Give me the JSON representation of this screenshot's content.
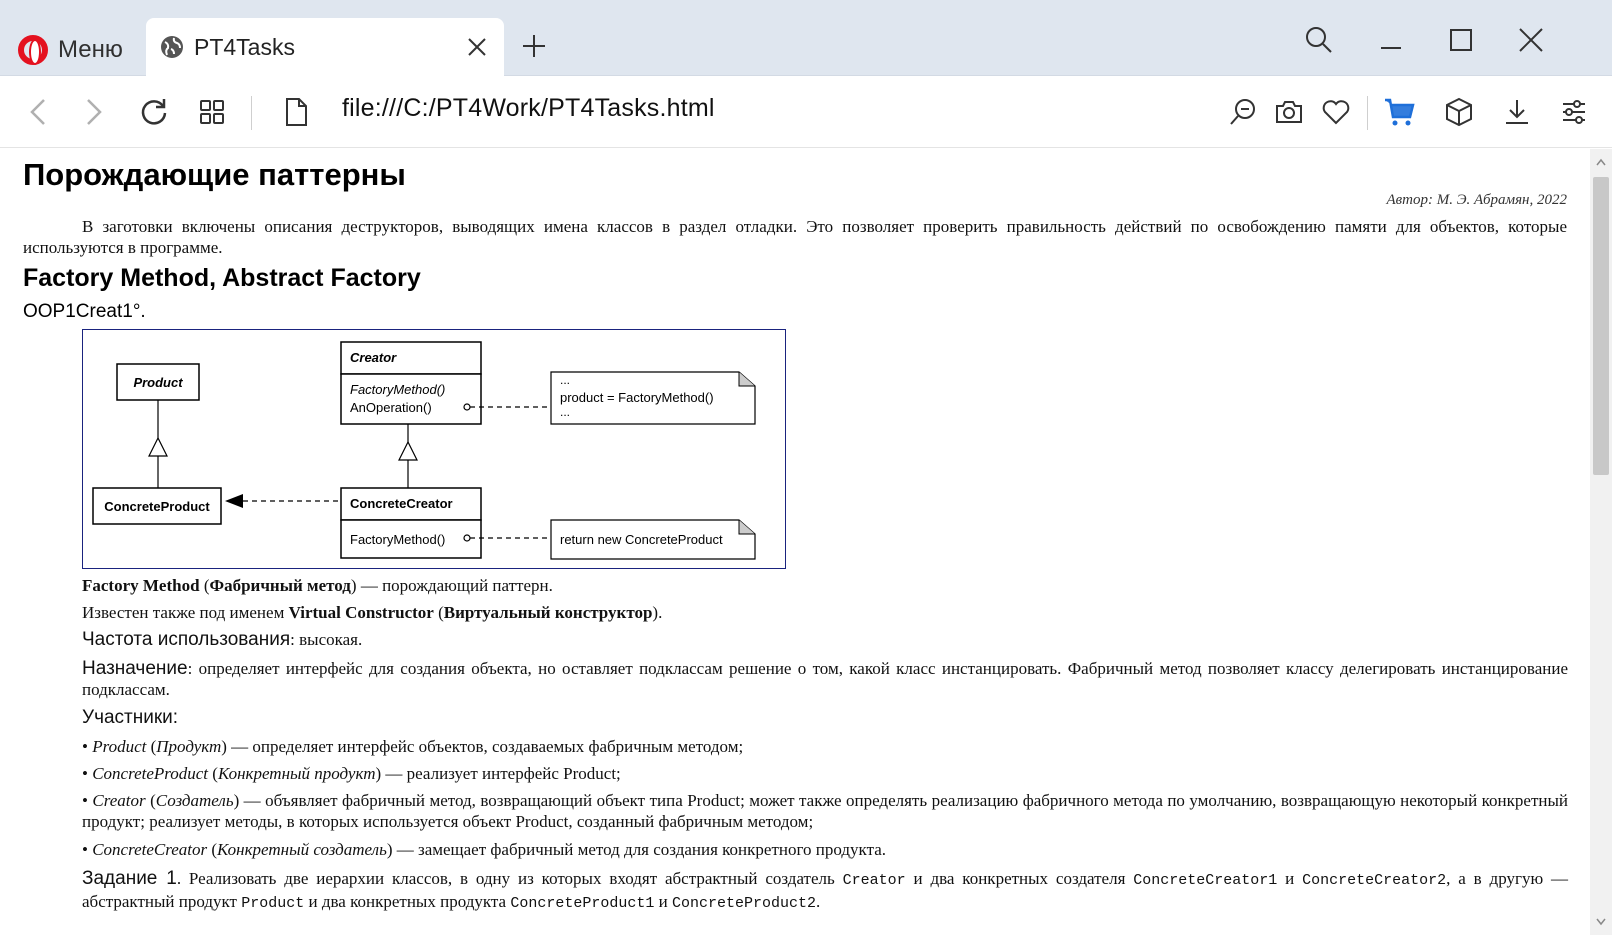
{
  "browser": {
    "menu_label": "Меню",
    "tab_title": "PT4Tasks",
    "url": "file:///C:/PT4Work/PT4Tasks.html"
  },
  "page": {
    "title": "Порождающие паттерны",
    "author": "Автор: М. Э. Абрамян, 2022",
    "intro": "В заготовки включены описания деструкторов, выводящих имена классов в раздел отладки. Это позволяет проверить правильность действий по освобождению памяти для объектов, которые используются в программе.",
    "section_title": "Factory Method, Abstract Factory",
    "task_name": "OOP1Creat1°.",
    "diagram": {
      "product": "Product",
      "concrete_product": "ConcreteProduct",
      "creator": "Creator",
      "creator_method1": "FactoryMethod()",
      "creator_method2": "AnOperation()",
      "concrete_creator": "ConcreteCreator",
      "concrete_creator_method": "FactoryMethod()",
      "note1_line1": "...",
      "note1_line2": "product = FactoryMethod()",
      "note1_line3": "...",
      "note2": "return new ConcreteProduct"
    },
    "desc1": {
      "name": "Factory Method",
      "p1": " (",
      "ru_name": "Фабричный метод",
      "p2": ") — порождающий паттерн."
    },
    "desc2": {
      "prefix": "Известен также под именем ",
      "name": "Virtual Constructor",
      "p1": " (",
      "ru_name": "Виртуальный конструктор",
      "p2": ")."
    },
    "frequency": {
      "label": "Частота использования",
      "value": ": высокая."
    },
    "purpose": {
      "label": "Назначение",
      "value": ": определяет интерфейс для создания объекта, но оставляет подклассам решение о том, какой класс инстанцировать. Фабричный метод позволяет классу делегировать инстанцирование подклассам."
    },
    "participants_label": "Участники:",
    "participants": [
      {
        "bullet": "• ",
        "name": "Product",
        "p1": " (",
        "ru": "Продукт",
        "rest": ") — определяет интерфейс объектов, создаваемых фабричным методом;"
      },
      {
        "bullet": "• ",
        "name": "ConcreteProduct",
        "p1": " (",
        "ru": "Конкретный продукт",
        "rest": ") — реализует интерфейс Product;"
      },
      {
        "bullet": "• ",
        "name": "Creator",
        "p1": " (",
        "ru": "Создатель",
        "rest": ") — объявляет фабричный метод, возвращающий объект типа Product; может также определять реализацию фабричного метода по умолчанию, возвращающую некоторый конкретный продукт; реализует методы, в которых используется объект Product, созданный фабричным методом;"
      },
      {
        "bullet": "• ",
        "name": "ConcreteCreator",
        "p1": " (",
        "ru": "Конкретный создатель",
        "rest": ") — замещает фабричный метод для создания конкретного продукта."
      }
    ],
    "task": {
      "label": "Задание 1",
      "t1": ". Реализовать две иерархии классов, в одну из которых входят абстрактный создатель ",
      "c1": "Creator",
      "t2": " и два конкретных создателя ",
      "c2": "ConcreteCreator1",
      "t3": " и ",
      "c3": "ConcreteCreator2",
      "t4": ", а в другую — абстрактный продукт ",
      "c4": "Product",
      "t5": " и два конкретных продукта ",
      "c5": "ConcreteProduct1",
      "t6": " и ",
      "c6": "ConcreteProduct2",
      "t7": "."
    }
  },
  "colors": {
    "tabbar": "#dfe6ef",
    "accent_cart": "#1e6fd9",
    "opera_red": "#e4111f",
    "diagram_border": "#1a237e"
  },
  "icons": [
    "opera-logo-icon",
    "globe-icon",
    "close-icon",
    "plus-icon",
    "search-icon",
    "minimize-icon",
    "maximize-icon",
    "back-icon",
    "forward-icon",
    "reload-icon",
    "tabs-grid-icon",
    "page-icon",
    "zoom-out-icon",
    "camera-icon",
    "heart-icon",
    "cart-icon",
    "cube-icon",
    "download-icon",
    "settings-icon"
  ]
}
